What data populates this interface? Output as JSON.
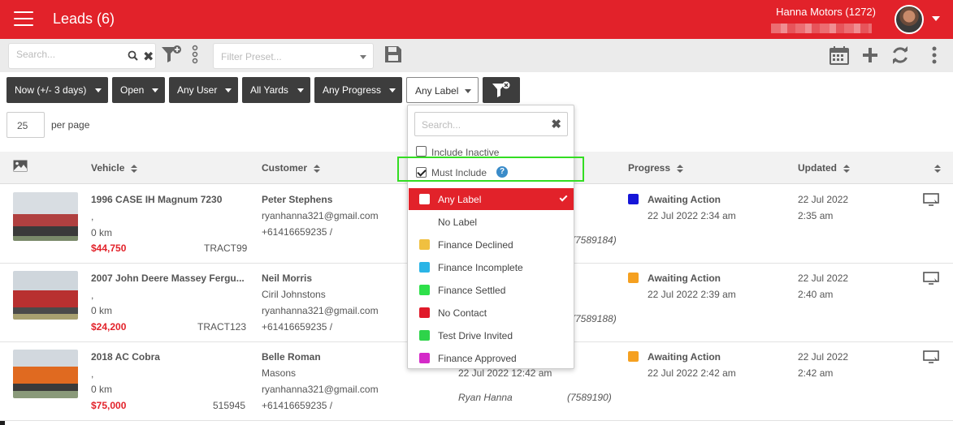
{
  "header": {
    "title": "Leads (6)",
    "company": "Hanna Motors (1272)"
  },
  "toolbar": {
    "search_placeholder": "Search...",
    "preset_placeholder": "Filter Preset..."
  },
  "filters": [
    {
      "label": "Now (+/- 3 days)"
    },
    {
      "label": "Open"
    },
    {
      "label": "Any User"
    },
    {
      "label": "All Yards"
    },
    {
      "label": "Any Progress"
    },
    {
      "label": "Any Label"
    }
  ],
  "pagination": {
    "per_page_value": "25",
    "per_page_label": "per page"
  },
  "table": {
    "headers": {
      "vehicle": "Vehicle",
      "customer": "Customer",
      "progress": "Progress",
      "updated": "Updated"
    },
    "rows": [
      {
        "vehicle": "1996 CASE IH Magnum 7230",
        "vehicle_sub": ",",
        "km": "0 km",
        "price": "$44,750",
        "stock": "TRACT99",
        "customer_name": "Peter Stephens",
        "customer_lines": [
          "ryanhanna321@gmail.com",
          "+61416659235 /"
        ],
        "assigned_id": "(7589184)",
        "progress_status": "Awaiting Action",
        "progress_date": "22 Jul 2022 2:34 am",
        "progress_color": "#1515d8",
        "updated_date": "22 Jul 2022",
        "updated_time": "2:35 am"
      },
      {
        "vehicle": "2007 John Deere Massey Fergu...",
        "vehicle_sub": ",",
        "km": "0 km",
        "price": "$24,200",
        "stock": "TRACT123",
        "customer_name": "Neil Morris",
        "customer_lines": [
          "Ciril Johnstons",
          "ryanhanna321@gmail.com",
          "+61416659235 /"
        ],
        "assigned_id": "(7589188)",
        "progress_status": "Awaiting Action",
        "progress_date": "22 Jul 2022 2:39 am",
        "progress_color": "#f5a020",
        "updated_date": "22 Jul 2022",
        "updated_time": "2:40 am"
      },
      {
        "vehicle": "2018 AC Cobra",
        "vehicle_sub": ",",
        "km": "0 km",
        "price": "$75,000",
        "stock": "515945",
        "customer_name": "Belle Roman",
        "customer_lines": [
          "Masons",
          "ryanhanna321@gmail.com",
          "+61416659235 /"
        ],
        "assigned_date": "22 Jul 2022 12:42 am",
        "assigned_user": "Ryan Hanna",
        "assigned_id": "(7589190)",
        "progress_status": "Awaiting Action",
        "progress_date": "22 Jul 2022 2:42 am",
        "progress_color": "#f5a020",
        "updated_date": "22 Jul 2022",
        "updated_time": "2:42 am"
      }
    ]
  },
  "label_dropdown": {
    "search_placeholder": "Search...",
    "include_inactive": "Include Inactive",
    "must_include": "Must Include",
    "help_glyph": "?",
    "options": [
      {
        "label": "Any Label",
        "color": "#ffffff",
        "selected": true
      },
      {
        "label": "No Label",
        "color": "",
        "selected": false
      },
      {
        "label": "Finance Declined",
        "color": "#f0c040",
        "selected": false
      },
      {
        "label": "Finance Incomplete",
        "color": "#2ab4e6",
        "selected": false
      },
      {
        "label": "Finance Settled",
        "color": "#2ee04a",
        "selected": false
      },
      {
        "label": "No Contact",
        "color": "#e01a2a",
        "selected": false
      },
      {
        "label": "Test Drive Invited",
        "color": "#2ed44a",
        "selected": false
      },
      {
        "label": "Finance Approved",
        "color": "#d42ac8",
        "selected": false
      }
    ]
  }
}
